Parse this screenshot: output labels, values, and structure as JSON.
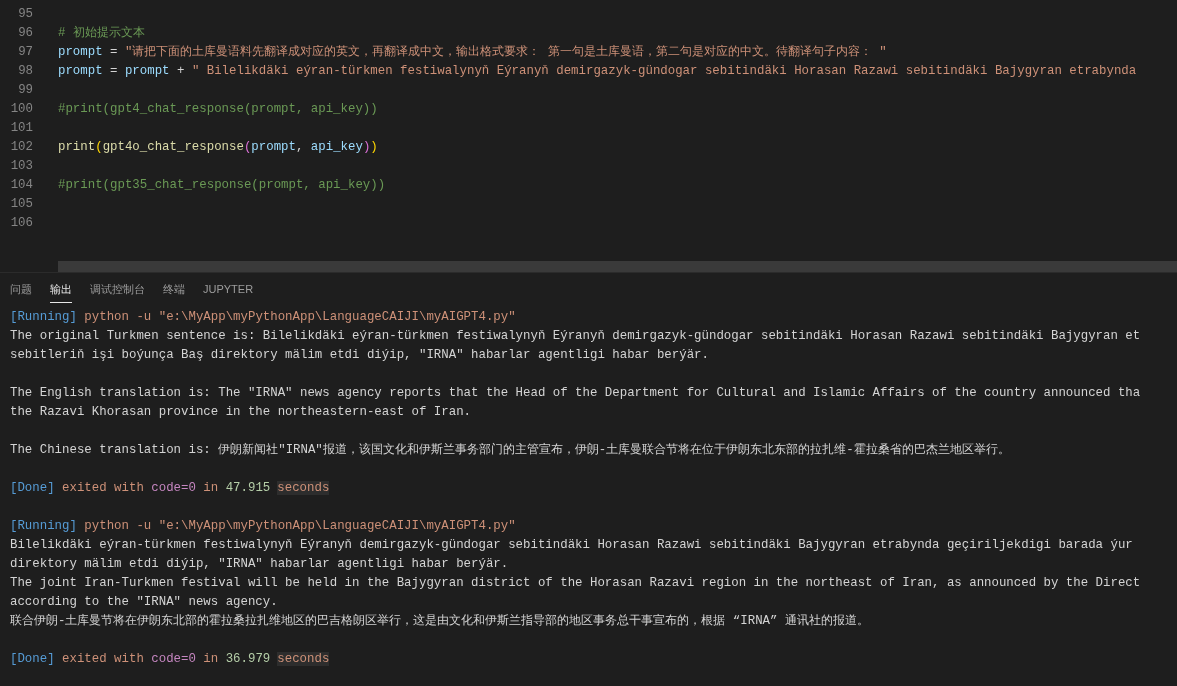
{
  "editor": {
    "lines": [
      {
        "number": "95"
      },
      {
        "number": "96",
        "tokens": [
          {
            "kind": "comment",
            "text": "# 初始提示文本"
          }
        ]
      },
      {
        "number": "97",
        "tokens": [
          {
            "kind": "variable",
            "text": "prompt"
          },
          {
            "kind": "plain",
            "text": " = "
          },
          {
            "kind": "string",
            "text": "\"请把下面的土库曼语料先翻译成对应的英文，再翻译成中文，输出格式要求： 第一句是土库曼语，第二句是对应的中文。待翻译句子内容： \""
          }
        ]
      },
      {
        "number": "98",
        "tokens": [
          {
            "kind": "variable",
            "text": "prompt"
          },
          {
            "kind": "plain",
            "text": " = "
          },
          {
            "kind": "variable",
            "text": "prompt"
          },
          {
            "kind": "plain",
            "text": " + "
          },
          {
            "kind": "string",
            "text": "\" Bilelikdäki eýran-türkmen festiwalynyň Eýranyň demirgazyk-gündogar sebitindäki Horasan Razawi sebitindäki Bajygyran etrabynda"
          }
        ]
      },
      {
        "number": "99"
      },
      {
        "number": "100",
        "tokens": [
          {
            "kind": "comment",
            "text": "#print(gpt4_chat_response(prompt, api_key))"
          }
        ]
      },
      {
        "number": "101"
      },
      {
        "number": "102",
        "tokens": [
          {
            "kind": "function",
            "text": "print"
          },
          {
            "kind": "bracket1",
            "text": "("
          },
          {
            "kind": "function",
            "text": "gpt4o_chat_response"
          },
          {
            "kind": "bracket2",
            "text": "("
          },
          {
            "kind": "variable",
            "text": "prompt"
          },
          {
            "kind": "plain",
            "text": ", "
          },
          {
            "kind": "variable",
            "text": "api_key"
          },
          {
            "kind": "bracket2",
            "text": ")"
          },
          {
            "kind": "bracket1",
            "text": ")"
          }
        ]
      },
      {
        "number": "103"
      },
      {
        "number": "104",
        "tokens": [
          {
            "kind": "comment",
            "text": "#print(gpt35_chat_response(prompt, api_key))"
          }
        ]
      },
      {
        "number": "105"
      },
      {
        "number": "106"
      }
    ]
  },
  "panel": {
    "tabs": [
      {
        "label": "问题",
        "selected": false
      },
      {
        "label": "输出",
        "selected": true
      },
      {
        "label": "调试控制台",
        "selected": false
      },
      {
        "label": "终端",
        "selected": false
      },
      {
        "label": "JUPYTER",
        "selected": false
      }
    ]
  },
  "output": {
    "blocks": [
      {
        "lines": [
          [
            {
              "kind": "tag",
              "text": "[Running]"
            },
            {
              "kind": "cmd",
              "text": " python -u \"e:\\MyApp\\myPythonApp\\LanguageCAIJI\\myAIGPT4.py\""
            }
          ],
          [
            {
              "kind": "text",
              "text": "The original Turkmen sentence is: Bilelikdäki eýran-türkmen festiwalynyň Eýranyň demirgazyk-gündogar sebitindäki Horasan Razawi sebitindäki Bajygyran et"
            }
          ],
          [
            {
              "kind": "text",
              "text": "sebitleriň işi boýunça Baş direktory mälim etdi diýip, \"IRNA\" habarlar agentligi habar berýär."
            }
          ]
        ]
      },
      {
        "lines": [
          [
            {
              "kind": "text",
              "text": "The English translation is: The \"IRNA\" news agency reports that the Head of the Department for Cultural and Islamic Affairs of the country announced tha"
            }
          ],
          [
            {
              "kind": "text",
              "text": "the Razavi Khorasan province in the northeastern-east of Iran."
            }
          ]
        ]
      },
      {
        "lines": [
          [
            {
              "kind": "text",
              "text": "The Chinese translation is: 伊朗新闻社\"IRNA\"报道，该国文化和伊斯兰事务部门的主管宣布，伊朗-土库曼联合节将在位于伊朗东北东部的拉扎维-霍拉桑省的巴杰兰地区举行。"
            }
          ]
        ]
      },
      {
        "lines": [
          [
            {
              "kind": "tag",
              "text": "[Done]"
            },
            {
              "kind": "cmd",
              "text": " exited with "
            },
            {
              "kind": "code",
              "text": "code=0"
            },
            {
              "kind": "cmd",
              "text": " in "
            },
            {
              "kind": "number",
              "text": "47.915"
            },
            {
              "kind": "highlight",
              "text": "seconds"
            }
          ]
        ]
      },
      {
        "lines": [
          [
            {
              "kind": "tag",
              "text": "[Running]"
            },
            {
              "kind": "cmd",
              "text": " python -u \"e:\\MyApp\\myPythonApp\\LanguageCAIJI\\myAIGPT4.py\""
            }
          ],
          [
            {
              "kind": "text",
              "text": "Bilelikdäki eýran-türkmen festiwalynyň Eýranyň demirgazyk-gündogar sebitindäki Horasan Razawi sebitindäki Bajygyran etrabynda geçiriljekdigi barada ýur"
            }
          ],
          [
            {
              "kind": "text",
              "text": "direktory mälim etdi diýip, \"IRNA\" habarlar agentligi habar berýär."
            }
          ],
          [
            {
              "kind": "text",
              "text": "The joint Iran-Turkmen festival will be held in the Bajygyran district of the Horasan Razavi region in the northeast of Iran, as announced by the Direct"
            }
          ],
          [
            {
              "kind": "text",
              "text": "according to the \"IRNA\" news agency."
            }
          ],
          [
            {
              "kind": "text",
              "text": "联合伊朗-土库曼节将在伊朗东北部的霍拉桑拉扎维地区的巴吉格朗区举行，这是由文化和伊斯兰指导部的地区事务总干事宣布的，根据 “IRNA” 通讯社的报道。"
            }
          ]
        ]
      },
      {
        "lines": [
          [
            {
              "kind": "tag",
              "text": "[Done]"
            },
            {
              "kind": "cmd",
              "text": " exited with "
            },
            {
              "kind": "code",
              "text": "code=0"
            },
            {
              "kind": "cmd",
              "text": " in "
            },
            {
              "kind": "number",
              "text": "36.979"
            },
            {
              "kind": "highlight",
              "text": "seconds"
            }
          ]
        ]
      }
    ]
  }
}
